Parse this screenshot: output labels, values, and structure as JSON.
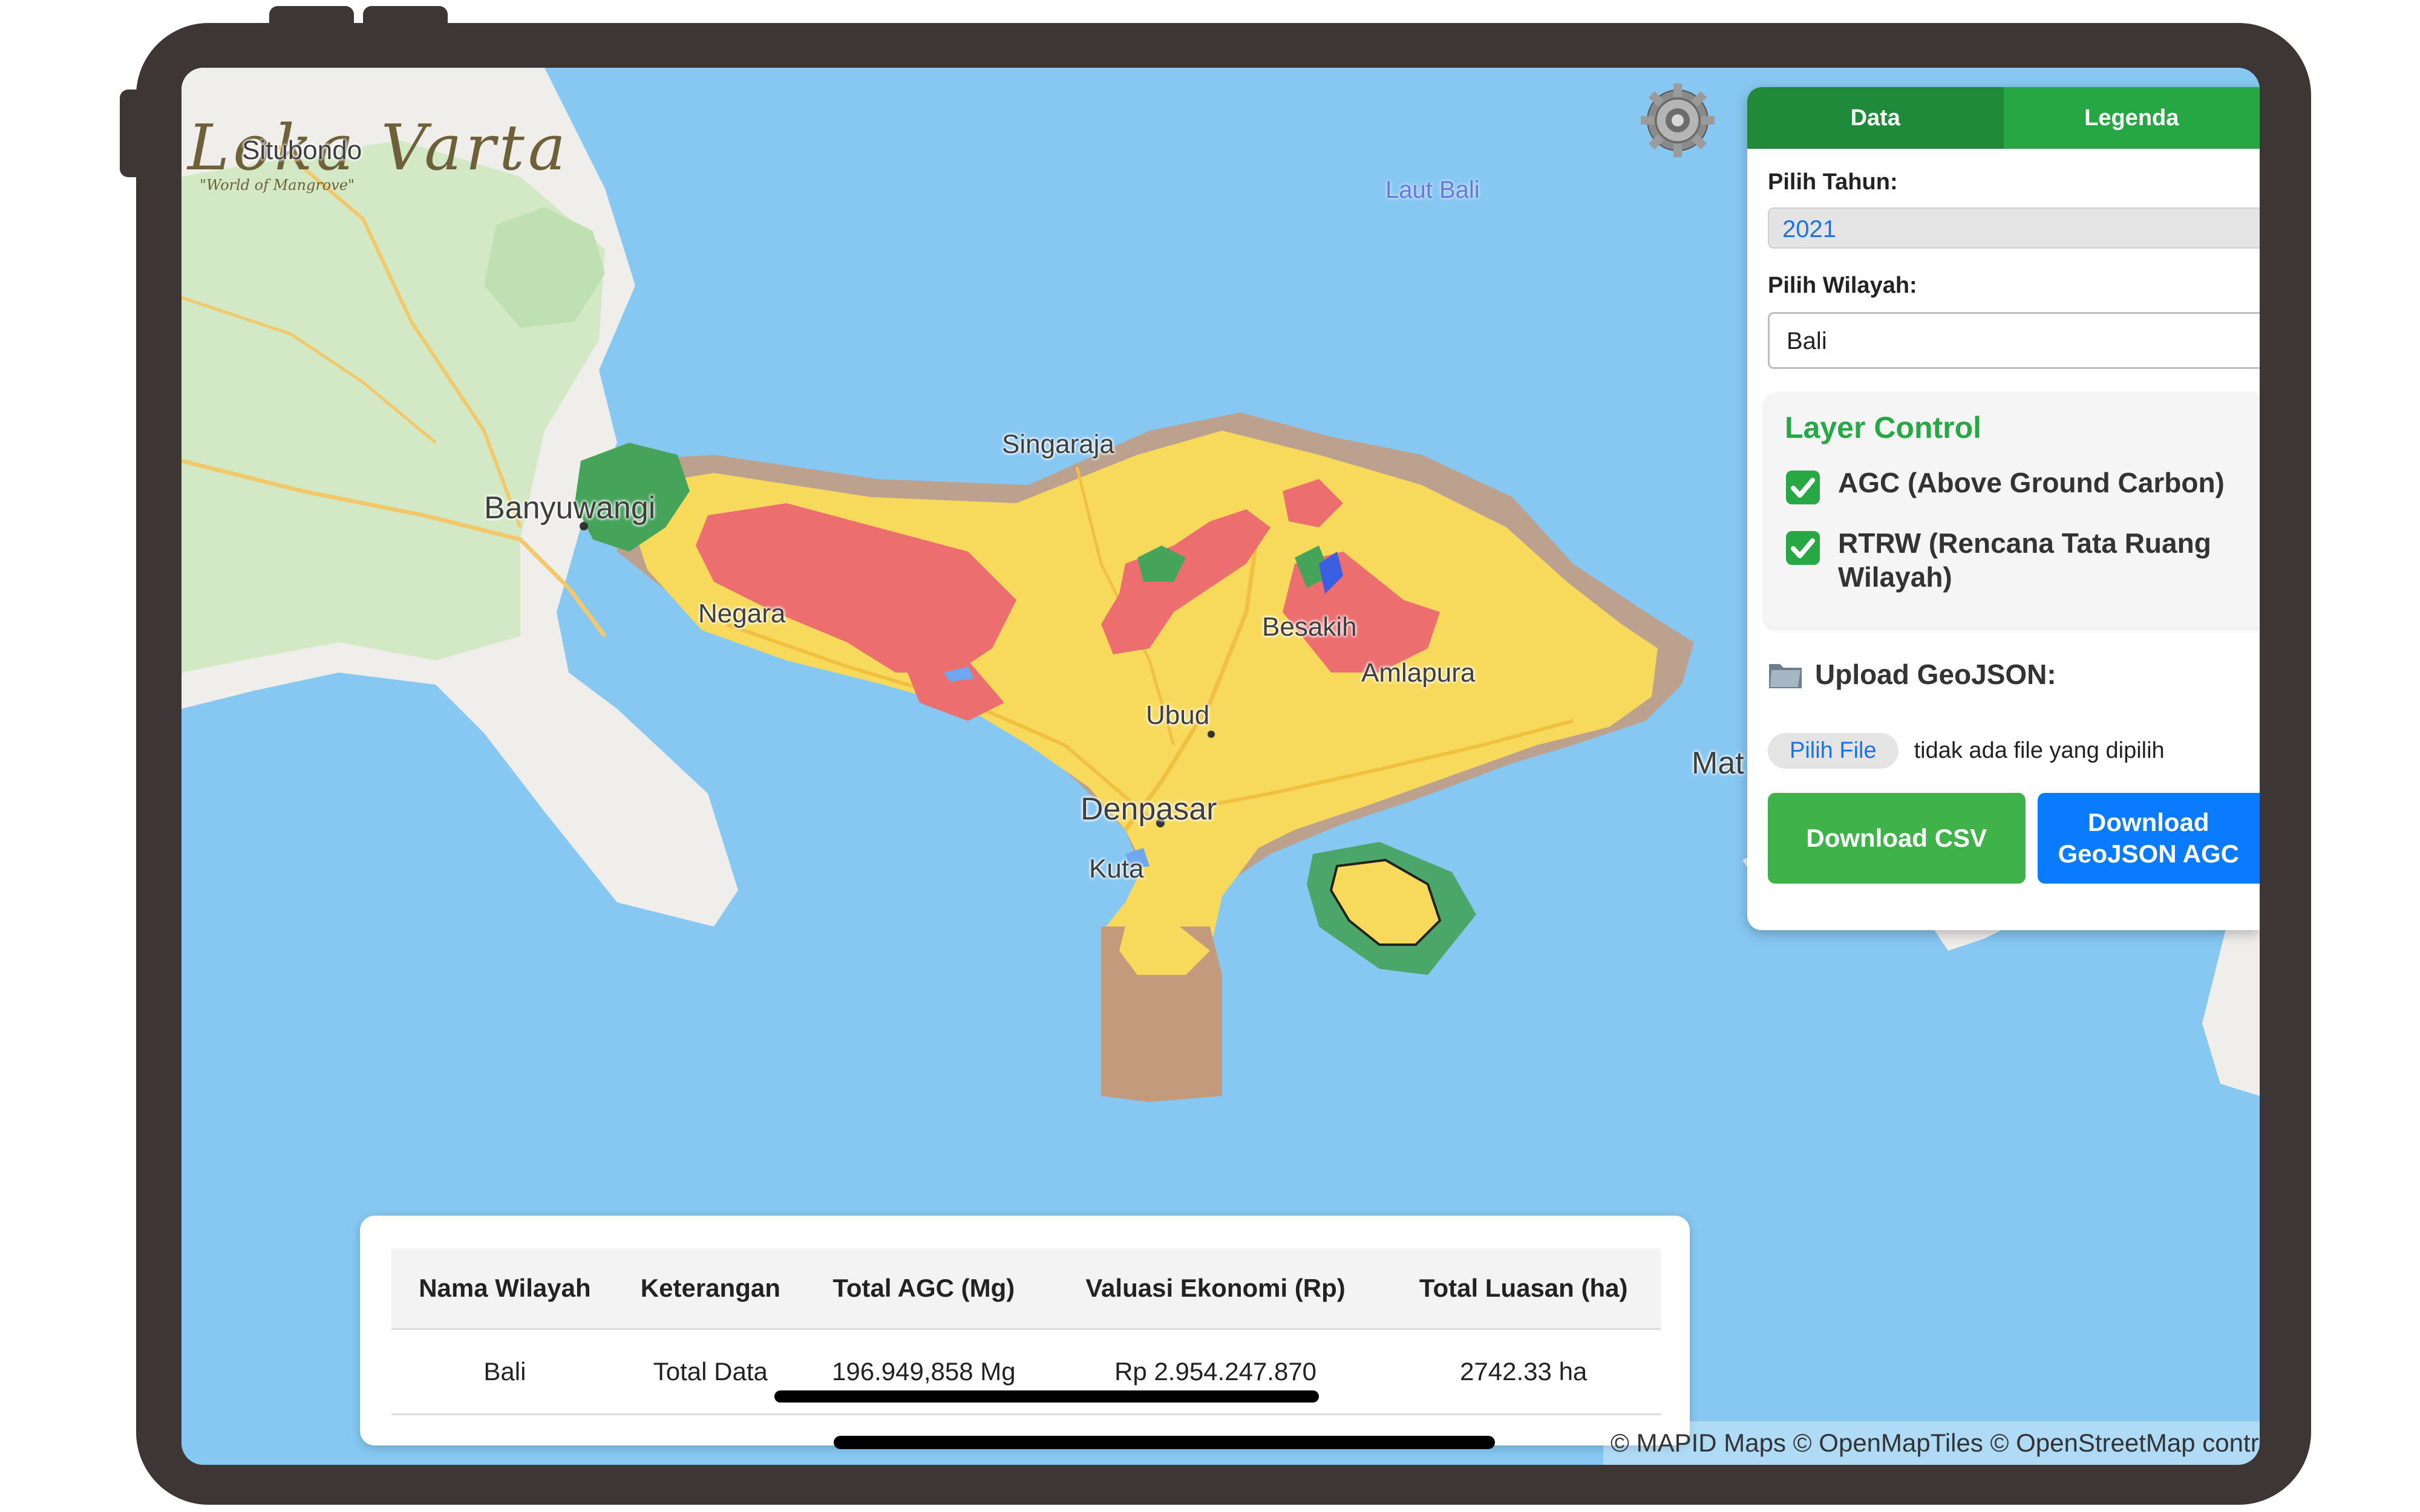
{
  "app": {
    "logo_text": "Loka Varta",
    "logo_tagline": "\"World of Mangrove\""
  },
  "map": {
    "places": {
      "situbondo": "Situbondo",
      "banyuwangi": "Banyuwangi",
      "laut_bali": "Laut Bali",
      "singaraja": "Singaraja",
      "negara": "Negara",
      "besakih": "Besakih",
      "amlapura": "Amlapura",
      "ubud": "Ubud",
      "denpasar": "Denpasar",
      "kuta": "Kuta",
      "mataram": "Mat"
    },
    "attribution": "© MAPID Maps © OpenMapTiles © OpenStreetMap contributors",
    "colors": {
      "sea": "#86c8f2",
      "land": "#f0eeea",
      "forest": "#cfe8c2",
      "rtrw_yellow": "#f7da5c",
      "rtrw_red": "#ec6e6e",
      "rtrw_green": "#45a35a",
      "rtrw_brown": "#c49a7c"
    }
  },
  "settings": {
    "icon": "gear-icon"
  },
  "panel": {
    "tabs": [
      {
        "label": "Data",
        "active": true
      },
      {
        "label": "Legenda",
        "active": false
      }
    ],
    "year_label": "Pilih Tahun:",
    "year_value": "2021",
    "region_label": "Pilih Wilayah:",
    "region_value": "Bali",
    "layer_control": {
      "title": "Layer Control",
      "layers": [
        {
          "label": "AGC (Above Ground Carbon)",
          "checked": true
        },
        {
          "label": "RTRW (Rencana Tata Ruang Wilayah)",
          "checked": true
        }
      ]
    },
    "upload_label": "Upload GeoJSON:",
    "file_button": "Pilih File",
    "file_status": "tidak ada file yang dipilih",
    "download_csv": "Download CSV",
    "download_geojson": "Download GeoJSON AGC"
  },
  "summary_table": {
    "headers": [
      "Nama Wilayah",
      "Keterangan",
      "Total AGC (Mg)",
      "Valuasi Ekonomi (Rp)",
      "Total Luasan (ha)"
    ],
    "rows": [
      [
        "Bali",
        "Total Data",
        "196.949,858 Mg",
        "Rp 2.954.247.870",
        "2742.33 ha"
      ]
    ]
  }
}
